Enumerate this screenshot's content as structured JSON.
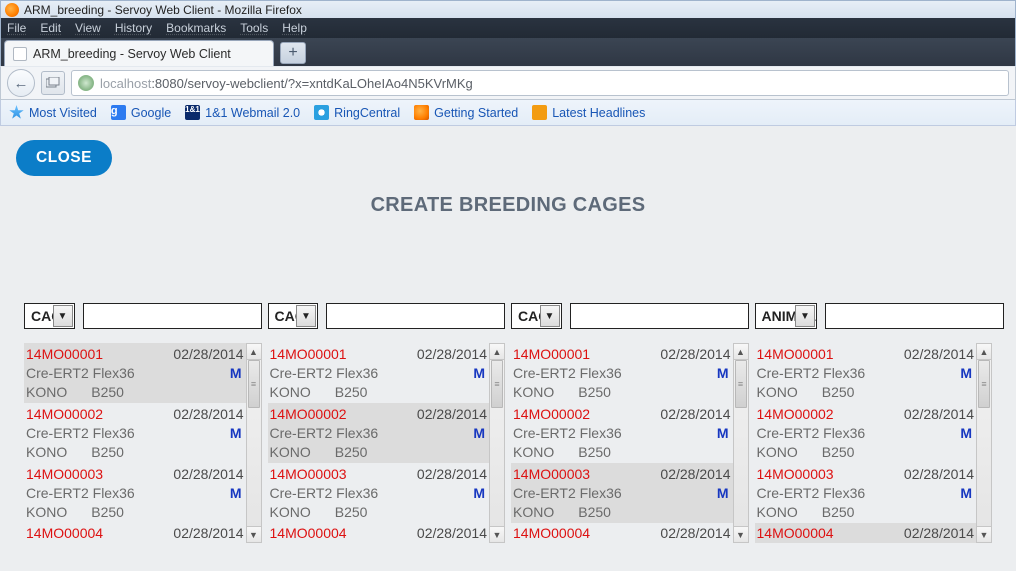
{
  "window": {
    "title": "ARM_breeding - Servoy Web Client - Mozilla Firefox",
    "menus": [
      "File",
      "Edit",
      "View",
      "History",
      "Bookmarks",
      "Tools",
      "Help"
    ]
  },
  "tab": {
    "label": "ARM_breeding - Servoy Web Client",
    "newtab": "+"
  },
  "nav": {
    "back": "←"
  },
  "url": {
    "host": "localhost",
    "port_path": ":8080/servoy-webclient/?x=xntdKaLOheIAo4N5KVrMKg"
  },
  "bookmarks": {
    "items": [
      "Most Visited",
      "Google",
      "1&1 Webmail 2.0",
      "RingCentral",
      "Getting Started",
      "Latest Headlines"
    ]
  },
  "page": {
    "close_label": "CLOSE",
    "title": "CREATE BREEDING CAGES"
  },
  "dropdown_options": {
    "cage": "CAGE",
    "animal": "ANIMAL"
  },
  "columns": [
    {
      "dropdown": "CAGE",
      "input": "",
      "selected_index": 0,
      "rows": [
        {
          "id": "14MO00001",
          "date": "02/28/2014",
          "strain": "Cre-ERT2 Flex36",
          "sex": "M",
          "pi": "KONO",
          "room": "B250"
        },
        {
          "id": "14MO00002",
          "date": "02/28/2014",
          "strain": "Cre-ERT2 Flex36",
          "sex": "M",
          "pi": "KONO",
          "room": "B250"
        },
        {
          "id": "14MO00003",
          "date": "02/28/2014",
          "strain": "Cre-ERT2 Flex36",
          "sex": "M",
          "pi": "KONO",
          "room": "B250"
        }
      ],
      "partial": {
        "id": "14MO00004",
        "date": "02/28/2014"
      }
    },
    {
      "dropdown": "CAGE",
      "input": "",
      "selected_index": 1,
      "rows": [
        {
          "id": "14MO00001",
          "date": "02/28/2014",
          "strain": "Cre-ERT2 Flex36",
          "sex": "M",
          "pi": "KONO",
          "room": "B250"
        },
        {
          "id": "14MO00002",
          "date": "02/28/2014",
          "strain": "Cre-ERT2 Flex36",
          "sex": "M",
          "pi": "KONO",
          "room": "B250"
        },
        {
          "id": "14MO00003",
          "date": "02/28/2014",
          "strain": "Cre-ERT2 Flex36",
          "sex": "M",
          "pi": "KONO",
          "room": "B250"
        }
      ],
      "partial": {
        "id": "14MO00004",
        "date": "02/28/2014"
      }
    },
    {
      "dropdown": "CAGE",
      "input": "",
      "selected_index": 2,
      "rows": [
        {
          "id": "14MO00001",
          "date": "02/28/2014",
          "strain": "Cre-ERT2 Flex36",
          "sex": "M",
          "pi": "KONO",
          "room": "B250"
        },
        {
          "id": "14MO00002",
          "date": "02/28/2014",
          "strain": "Cre-ERT2 Flex36",
          "sex": "M",
          "pi": "KONO",
          "room": "B250"
        },
        {
          "id": "14MO00003",
          "date": "02/28/2014",
          "strain": "Cre-ERT2 Flex36",
          "sex": "M",
          "pi": "KONO",
          "room": "B250"
        }
      ],
      "partial": {
        "id": "14MO00004",
        "date": "02/28/2014"
      }
    },
    {
      "dropdown": "ANIMAL",
      "input": "",
      "selected_index": 3,
      "rows": [
        {
          "id": "14MO00001",
          "date": "02/28/2014",
          "strain": "Cre-ERT2 Flex36",
          "sex": "M",
          "pi": "KONO",
          "room": "B250"
        },
        {
          "id": "14MO00002",
          "date": "02/28/2014",
          "strain": "Cre-ERT2 Flex36",
          "sex": "M",
          "pi": "KONO",
          "room": "B250"
        },
        {
          "id": "14MO00003",
          "date": "02/28/2014",
          "strain": "Cre-ERT2 Flex36",
          "sex": "M",
          "pi": "KONO",
          "room": "B250"
        }
      ],
      "partial": {
        "id": "14MO00004",
        "date": "02/28/2014"
      }
    }
  ]
}
